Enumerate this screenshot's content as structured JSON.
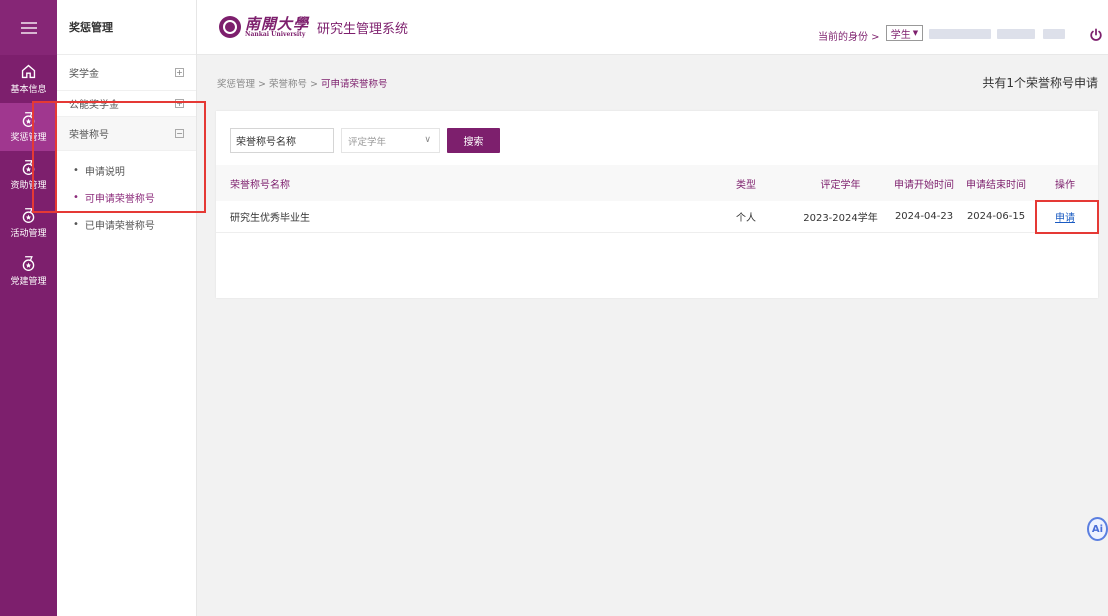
{
  "rail": {
    "items": [
      {
        "label": "基本信息",
        "icon": "home-icon"
      },
      {
        "label": "奖惩管理",
        "icon": "medal-icon"
      },
      {
        "label": "资助管理",
        "icon": "medal-icon"
      },
      {
        "label": "活动管理",
        "icon": "medal-icon"
      },
      {
        "label": "党建管理",
        "icon": "medal-icon"
      }
    ]
  },
  "sidebar": {
    "title": "奖惩管理",
    "groups": [
      {
        "label": "奖学金",
        "toggle": "+"
      },
      {
        "label": "公能奖学金",
        "toggle": "+"
      },
      {
        "label": "荣誉称号",
        "toggle": "−"
      }
    ],
    "sub_items": [
      {
        "label": "申请说明"
      },
      {
        "label": "可申请荣誉称号"
      },
      {
        "label": "已申请荣誉称号"
      }
    ]
  },
  "header": {
    "logo_cn": "南開大學",
    "logo_en": "Nankai University",
    "system_title": "研究生管理系统",
    "identity_label": "当前的身份 >",
    "role": "学生"
  },
  "breadcrumb": {
    "part1": "奖惩管理 > 荣誉称号 > ",
    "current": "可申请荣誉称号"
  },
  "count_info": "共有1个荣誉称号申请",
  "search": {
    "name_value": "荣誉称号名称",
    "year_placeholder": "评定学年",
    "button": "搜索"
  },
  "table": {
    "headers": [
      "荣誉称号名称",
      "类型",
      "评定学年",
      "申请开始时间",
      "申请结束时间",
      "操作"
    ],
    "rows": [
      {
        "name": "研究生优秀毕业生",
        "type": "个人",
        "year": "2023-2024学年",
        "start": "2024-04-23",
        "end": "2024-06-15",
        "action": "申请"
      }
    ]
  },
  "colors": {
    "brand": "#7d1f6d",
    "highlight": "#e53935",
    "link": "#1a5bc2"
  }
}
